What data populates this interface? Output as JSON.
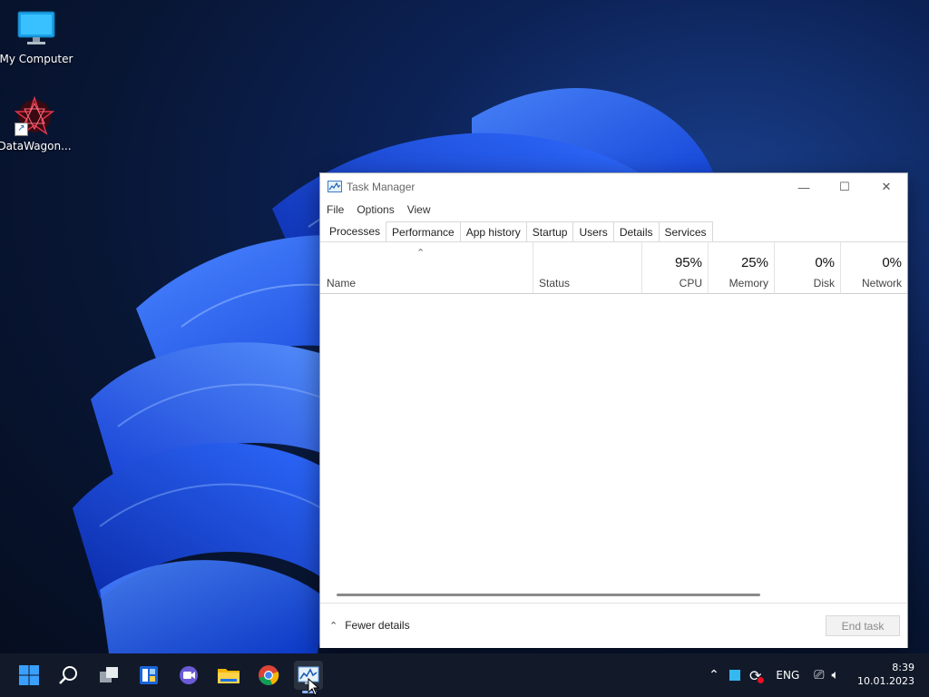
{
  "desktop": {
    "icons": [
      {
        "label": "My Computer",
        "icon": "monitor-icon"
      },
      {
        "label": "DataWagon...",
        "icon": "datawagon-logo-icon"
      }
    ]
  },
  "window": {
    "title": "Task Manager",
    "controls": {
      "minimize": "—",
      "maximize": "☐",
      "close": "✕"
    },
    "menu": [
      "File",
      "Options",
      "View"
    ],
    "tabs": [
      "Processes",
      "Performance",
      "App history",
      "Startup",
      "Users",
      "Details",
      "Services"
    ],
    "active_tab": "Processes",
    "columns": {
      "name": {
        "label": "Name"
      },
      "status": {
        "label": "Status"
      },
      "cpu": {
        "label": "CPU",
        "value": "95%"
      },
      "memory": {
        "label": "Memory",
        "value": "25%"
      },
      "disk": {
        "label": "Disk",
        "value": "0%"
      },
      "network": {
        "label": "Network",
        "value": "0%"
      }
    },
    "footer": {
      "fewer_details": "Fewer details",
      "end_task": "End task"
    }
  },
  "taskbar": {
    "apps": [
      "start-icon",
      "search-icon",
      "task-view-icon",
      "widgets-icon",
      "chat-icon",
      "file-explorer-icon",
      "chrome-icon",
      "task-manager-icon"
    ],
    "tray": {
      "language": "ENG"
    },
    "clock": {
      "time": "8:39",
      "date": "10.01.2023"
    }
  },
  "colors": {
    "accent": "#1a5fd8",
    "taskbar": "#121a2a"
  }
}
